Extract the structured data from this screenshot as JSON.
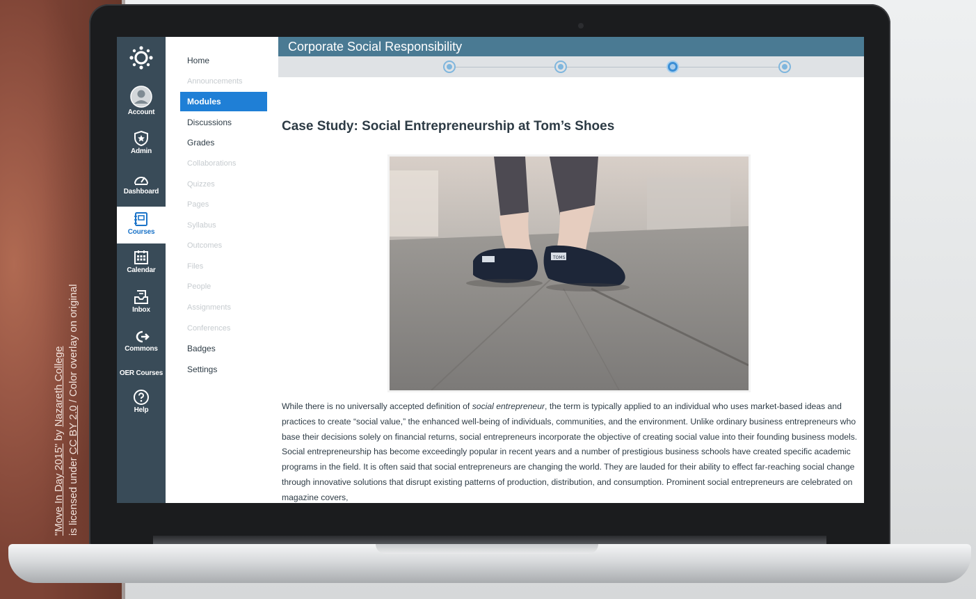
{
  "credit": {
    "line1_link1": "\"Move In Day 2015\"",
    "line1_by": " by ",
    "line1_link2": "Nazareth College",
    "line2_prefix": "is licensed under ",
    "line2_link": "CC BY 2.0",
    "line2_suffix": " / Color overlay on original"
  },
  "global_nav": {
    "items": [
      {
        "label": "Account",
        "icon": "account-icon"
      },
      {
        "label": "Admin",
        "icon": "shield-icon"
      },
      {
        "label": "Dashboard",
        "icon": "speedometer-icon"
      },
      {
        "label": "Courses",
        "icon": "book-icon"
      },
      {
        "label": "Calendar",
        "icon": "calendar-icon"
      },
      {
        "label": "Inbox",
        "icon": "inbox-icon"
      },
      {
        "label": "Commons",
        "icon": "commons-arrow-icon"
      },
      {
        "label": "OER Courses",
        "icon": ""
      },
      {
        "label": "Help",
        "icon": "help-icon"
      }
    ],
    "active": "Courses"
  },
  "course_nav": {
    "items": [
      {
        "label": "Home",
        "state": "normal"
      },
      {
        "label": "Announcements",
        "state": "muted"
      },
      {
        "label": "Modules",
        "state": "active"
      },
      {
        "label": "Discussions",
        "state": "normal"
      },
      {
        "label": "Grades",
        "state": "normal"
      },
      {
        "label": "Collaborations",
        "state": "muted"
      },
      {
        "label": "Quizzes",
        "state": "muted"
      },
      {
        "label": "Pages",
        "state": "muted"
      },
      {
        "label": "Syllabus",
        "state": "muted"
      },
      {
        "label": "Outcomes",
        "state": "muted"
      },
      {
        "label": "Files",
        "state": "muted"
      },
      {
        "label": "People",
        "state": "muted"
      },
      {
        "label": "Assignments",
        "state": "muted"
      },
      {
        "label": "Conferences",
        "state": "muted"
      },
      {
        "label": "Badges",
        "state": "normal"
      },
      {
        "label": "Settings",
        "state": "normal"
      }
    ]
  },
  "header": {
    "course_title": "Corporate Social Responsibility"
  },
  "progress": {
    "steps": 4,
    "current_step": 3
  },
  "page": {
    "title": "Case Study: Social Entrepreneurship at Tom’s Shoes",
    "image_alt": "feet wearing blue TOMS shoes on a wooden boardwalk",
    "shoe_label": "TOMS",
    "body_1": "While there is no universally accepted definition of ",
    "body_em": "social entrepreneur",
    "body_2": ", the term is typically applied to an individual who uses market-based ideas and practices to create “social value,” the enhanced well-being of individuals, communities, and the environment. Unlike ordinary business entrepreneurs who base their decisions solely on financial returns, social entrepreneurs incorporate the objective of creating social value into their founding business models. Social entrepreneurship has become exceedingly popular in recent years and a number of prestigious business schools have created specific academic programs in the field. It is often said that social entrepreneurs are changing the world. They are lauded for their ability to effect far-reaching social change through innovative solutions that disrupt existing patterns of production, distribution, and consumption. Prominent social entrepreneurs are celebrated on magazine covers,"
  },
  "colors": {
    "global_nav_bg": "#394b58",
    "header_bg": "#4a7a93",
    "active_blue": "#1f7fd6"
  }
}
